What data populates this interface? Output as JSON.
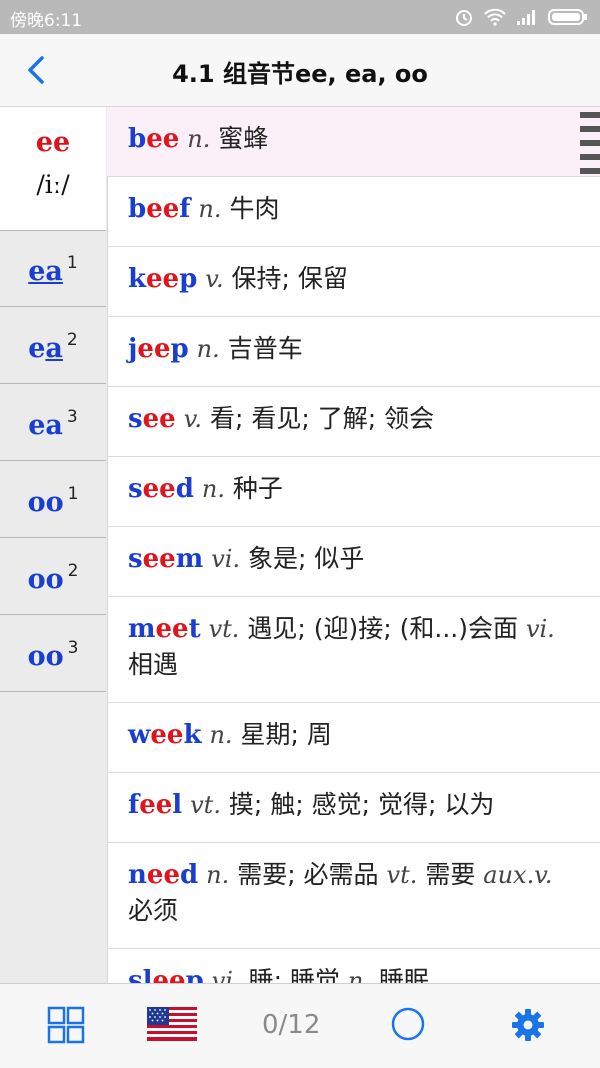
{
  "statusbar": {
    "time": "傍晚6:11"
  },
  "header": {
    "title": "4.1 组音节ee, ea, oo"
  },
  "tabs": [
    {
      "label": "ee",
      "ipa": "/iː/",
      "pre": "",
      "under": "",
      "post": "",
      "sup": ""
    },
    {
      "label": "",
      "pre": "",
      "under": "ea",
      "post": "",
      "sup": "1"
    },
    {
      "label": "",
      "pre": "e",
      "under": "a",
      "post": "",
      "sup": "2"
    },
    {
      "label": "",
      "pre": "ea",
      "under": "",
      "post": "",
      "sup": "3"
    },
    {
      "label": "",
      "pre": "oo",
      "under": "",
      "post": "",
      "sup": "1"
    },
    {
      "label": "",
      "pre": "oo",
      "under": "",
      "post": "",
      "sup": "2"
    },
    {
      "label": "",
      "pre": "oo",
      "under": "",
      "post": "",
      "sup": "3"
    }
  ],
  "words": [
    {
      "pre": "b",
      "hl": "ee",
      "post": "",
      "pos": "n.",
      "meaning": "蜜蜂",
      "pos2": "",
      "meaning2": ""
    },
    {
      "pre": "b",
      "hl": "ee",
      "post": "f",
      "pos": "n.",
      "meaning": "牛肉",
      "pos2": "",
      "meaning2": ""
    },
    {
      "pre": "k",
      "hl": "ee",
      "post": "p",
      "pos": "v.",
      "meaning": "保持; 保留",
      "pos2": "",
      "meaning2": ""
    },
    {
      "pre": "j",
      "hl": "ee",
      "post": "p",
      "pos": "n.",
      "meaning": "吉普车",
      "pos2": "",
      "meaning2": ""
    },
    {
      "pre": "s",
      "hl": "ee",
      "post": "",
      "pos": "v.",
      "meaning": "看; 看见; 了解; 领会",
      "pos2": "",
      "meaning2": ""
    },
    {
      "pre": "s",
      "hl": "ee",
      "post": "d",
      "pos": "n.",
      "meaning": "种子",
      "pos2": "",
      "meaning2": ""
    },
    {
      "pre": "s",
      "hl": "ee",
      "post": "m",
      "pos": "vi.",
      "meaning": "象是; 似乎",
      "pos2": "",
      "meaning2": ""
    },
    {
      "pre": "m",
      "hl": "ee",
      "post": "t",
      "pos": "vt.",
      "meaning": "遇见; (迎)接; (和...)会面",
      "pos2": "vi.",
      "meaning2": "相遇"
    },
    {
      "pre": "w",
      "hl": "ee",
      "post": "k",
      "pos": "n.",
      "meaning": "星期; 周",
      "pos2": "",
      "meaning2": ""
    },
    {
      "pre": "f",
      "hl": "ee",
      "post": "l",
      "pos": "vt.",
      "meaning": "摸; 触; 感觉; 觉得; 以为",
      "pos2": "",
      "meaning2": ""
    },
    {
      "pre": "n",
      "hl": "ee",
      "post": "d",
      "pos": "n.",
      "meaning": "需要; 必需品",
      "pos2": "vt.",
      "meaning2": "需要",
      "pos3": "aux.v.",
      "meaning3": "必须"
    },
    {
      "pre": "sl",
      "hl": "ee",
      "post": "p",
      "pos": "vi.",
      "meaning": "睡; 睡觉",
      "pos2": "n.",
      "meaning2": "睡眠"
    }
  ],
  "bottombar": {
    "counter": "0/12"
  },
  "colors": {
    "accent": "#1a73e8",
    "word": "#1a3ecf",
    "highlight": "#e0141c"
  },
  "icons": [
    "back-chevron-icon",
    "grid-icon",
    "us-flag-icon",
    "circle-icon",
    "gear-icon",
    "wifi-icon",
    "signal-icon",
    "battery-icon",
    "alarm-icon"
  ]
}
